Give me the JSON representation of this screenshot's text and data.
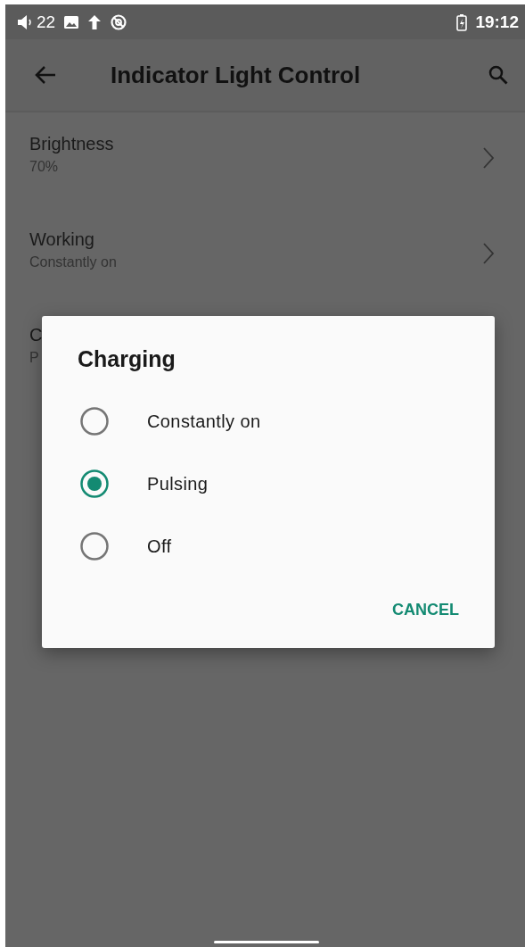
{
  "status_bar": {
    "volume": "22",
    "time": "19:12"
  },
  "app_bar": {
    "title": "Indicator Light Control"
  },
  "settings": [
    {
      "title": "Brightness",
      "value": "70%"
    },
    {
      "title": "Working",
      "value": "Constantly on"
    },
    {
      "title": "C",
      "value": "P"
    }
  ],
  "dialog": {
    "title": "Charging",
    "options": [
      {
        "label": "Constantly on",
        "selected": false
      },
      {
        "label": "Pulsing",
        "selected": true
      },
      {
        "label": "Off",
        "selected": false
      }
    ],
    "button": "CANCEL"
  }
}
